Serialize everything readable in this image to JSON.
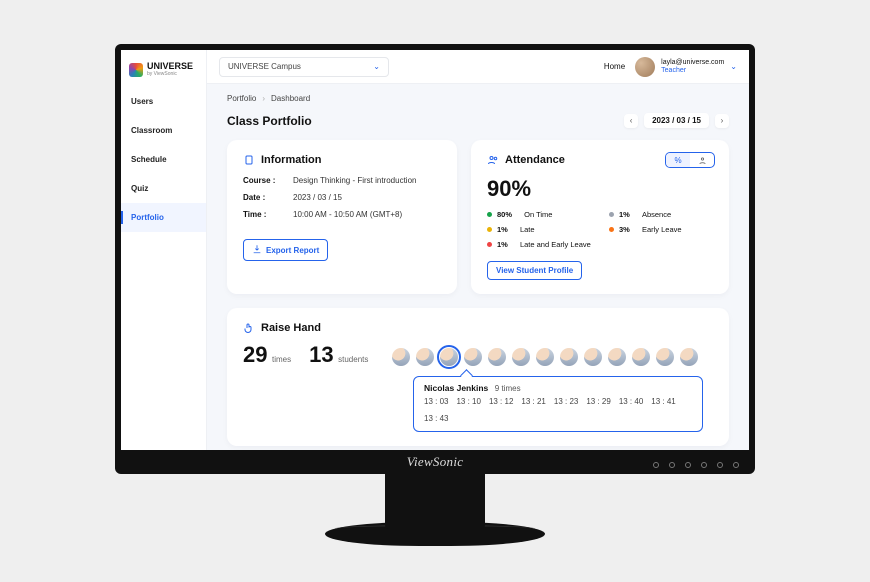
{
  "brand": {
    "logo_text": "UNIVERSE",
    "logo_sub": "by ViewSonic"
  },
  "campus_selector": {
    "label": "UNIVERSE Campus"
  },
  "topbar": {
    "home": "Home"
  },
  "user": {
    "email": "layla@universe.com",
    "role": "Teacher"
  },
  "nav": {
    "users": "Users",
    "classroom": "Classroom",
    "schedule": "Schedule",
    "quiz": "Quiz",
    "portfolio": "Portfolio"
  },
  "breadcrumb": {
    "a": "Portfolio",
    "b": "Dashboard"
  },
  "page": {
    "title": "Class Portfolio",
    "date": "2023 / 03 / 15"
  },
  "info": {
    "title": "Information",
    "course_label": "Course :",
    "course_value": "Design Thinking - First introduction",
    "date_label": "Date :",
    "date_value": "2023 / 03 / 15",
    "time_label": "Time :",
    "time_value": "10:00 AM - 10:50 AM (GMT+8)",
    "export_btn": "Export Report"
  },
  "attendance": {
    "title": "Attendance",
    "overall": "90%",
    "legend": {
      "ontime": {
        "pct": "80%",
        "label": "On Time"
      },
      "absence": {
        "pct": "1%",
        "label": "Absence"
      },
      "late": {
        "pct": "1%",
        "label": "Late"
      },
      "earlyleave": {
        "pct": "3%",
        "label": "Early Leave"
      },
      "lateearly": {
        "pct": "1%",
        "label": "Late and Early Leave"
      }
    },
    "view_btn": "View Student Profile"
  },
  "raise": {
    "title": "Raise Hand",
    "times_n": "29",
    "times_u": "times",
    "students_n": "13",
    "students_u": "students",
    "popover": {
      "name": "Nicolas Jenkins",
      "count": "9 times",
      "stamps": [
        "13 : 03",
        "13 : 10",
        "13 : 12",
        "13 : 21",
        "13 : 23",
        "13 : 29",
        "13 : 40",
        "13 : 41",
        "13 : 43"
      ]
    }
  }
}
